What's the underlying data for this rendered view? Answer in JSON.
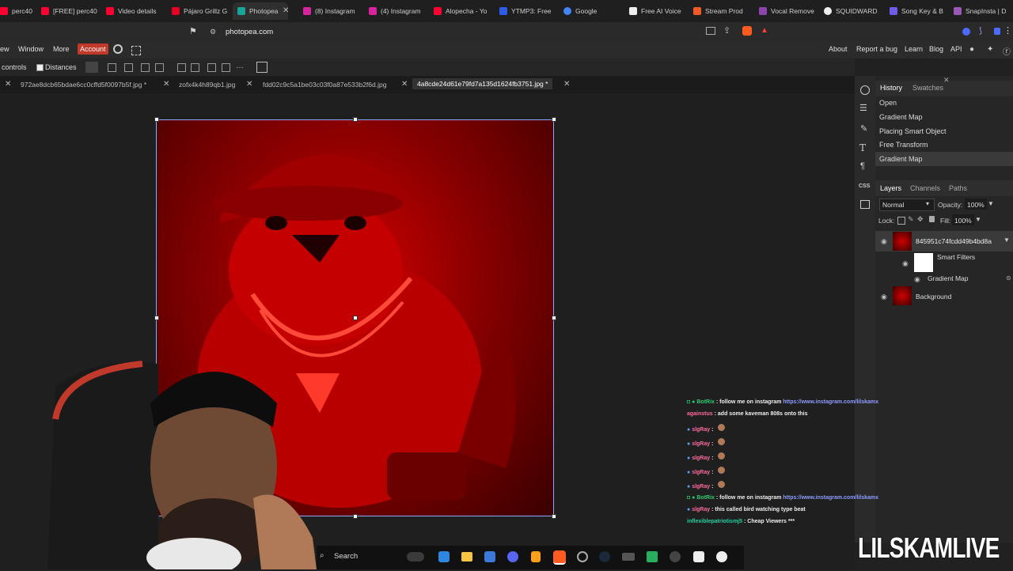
{
  "browser": {
    "tabs": [
      {
        "label": "perc40",
        "color": "#ff0033"
      },
      {
        "label": "[FREE] perc40",
        "color": "#ff0033"
      },
      {
        "label": "Video details",
        "color": "#ff0033"
      },
      {
        "label": "Pájaro Grillz G",
        "color": "#e60023"
      },
      {
        "label": "Photopea",
        "color": "#18a497"
      },
      {
        "label": "(8) Instagram",
        "color": "#d6249f"
      },
      {
        "label": "(4) Instagram",
        "color": "#d6249f"
      },
      {
        "label": "Alopecha - Yo",
        "color": "#ff0033"
      },
      {
        "label": "YTMP3: Free",
        "color": "#2f5bea"
      },
      {
        "label": "Google",
        "color": "#4285f4"
      },
      {
        "label": "Free AI Voice",
        "color": "#222222"
      },
      {
        "label": "Stream Prod",
        "color": "#f05a28"
      },
      {
        "label": "Vocal Remove",
        "color": "#8e44ad"
      },
      {
        "label": "SQUIDWARD",
        "color": "#eeeeee"
      },
      {
        "label": "Song Key & B",
        "color": "#6c5ce7"
      },
      {
        "label": "SnapInsta | D",
        "color": "#9b59b6"
      }
    ],
    "url": "photopea.com"
  },
  "menu": {
    "items": [
      "ew",
      "Window",
      "More"
    ],
    "account": "Account",
    "right_links": [
      "About",
      "Report a bug",
      "Learn",
      "Blog",
      "API"
    ]
  },
  "options": {
    "controls": "controls",
    "distances": "Distances"
  },
  "documents": [
    "972ae8dcb65bdae6cc0cffd5f0097b5f.jpg *",
    "zofx4k4h89qb1.jpg",
    "fdd02c9c5a1be03c03f0a87e533b2f6d.jpg",
    "4a8cde24d61e79fd7a135d1624fb3751.jpg *"
  ],
  "history": {
    "tabs": [
      "History",
      "Swatches"
    ],
    "entries": [
      "Open",
      "Gradient Map",
      "Placing Smart Object",
      "Free Transform",
      "Gradient Map"
    ]
  },
  "layers": {
    "tabs": [
      "Layers",
      "Channels",
      "Paths"
    ],
    "blend_mode": "Normal",
    "opacity_label": "Opacity:",
    "opacity": "100%",
    "lock_label": "Lock:",
    "fill_label": "Fill:",
    "fill": "100%",
    "items": [
      {
        "name": "845951c74fcdd49b4bd8a"
      },
      {
        "name": "Smart Filters"
      },
      {
        "name": "Gradient Map"
      },
      {
        "name": "Background"
      }
    ]
  },
  "chat": [
    {
      "user": "BotRix",
      "text": ": follow me on instagram",
      "link": "https://www.instagram.com/lilskamx"
    },
    {
      "user": "againstus",
      "text": ": add some kaveman 808s onto this",
      "link": ""
    },
    {
      "user": "slgRay",
      "text": ":",
      "link": ""
    },
    {
      "user": "slgRay",
      "text": ":",
      "link": ""
    },
    {
      "user": "slgRay",
      "text": ":",
      "link": ""
    },
    {
      "user": "slgRay",
      "text": ":",
      "link": ""
    },
    {
      "user": "slgRay",
      "text": ":",
      "link": ""
    },
    {
      "user": "BotRix",
      "text": ": follow me on instagram",
      "link": "https://www.instagram.com/lilskamx"
    },
    {
      "user": "slgRay",
      "text": ": this called bird watching type beat",
      "link": ""
    },
    {
      "user": "inflexiblepatriotismj5",
      "text": ": Cheap Viewers ***",
      "link": ""
    }
  ],
  "taskbar": {
    "search": "Search"
  },
  "watermark": "LILSKAMLIVE"
}
